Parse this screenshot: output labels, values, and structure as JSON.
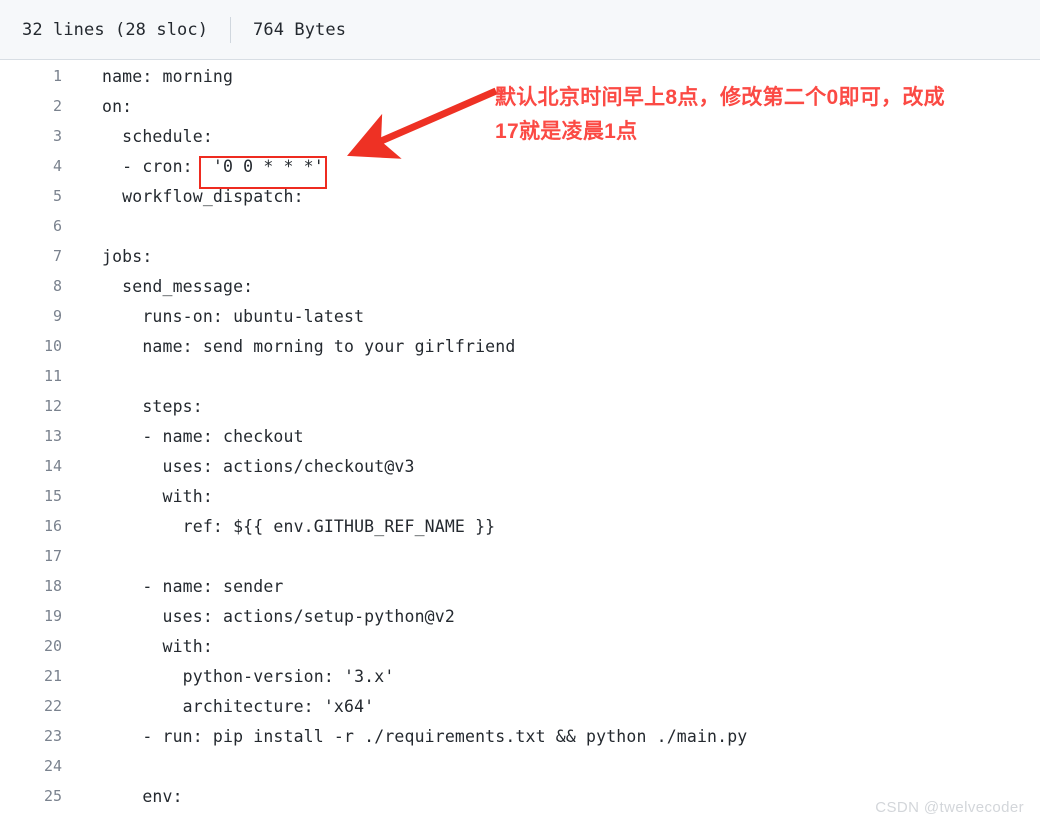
{
  "header": {
    "lines_label": "32 lines (28 sloc)",
    "size_label": "764 Bytes",
    "divider": "|"
  },
  "code": {
    "language": "yaml",
    "filename_hint": "morning workflow",
    "lines": [
      {
        "n": "1",
        "text": "name: morning"
      },
      {
        "n": "2",
        "text": "on:"
      },
      {
        "n": "3",
        "text": "  schedule:"
      },
      {
        "n": "4",
        "text": "  - cron:  '0 0 * * *'"
      },
      {
        "n": "5",
        "text": "  workflow_dispatch:"
      },
      {
        "n": "6",
        "text": ""
      },
      {
        "n": "7",
        "text": "jobs:"
      },
      {
        "n": "8",
        "text": "  send_message:"
      },
      {
        "n": "9",
        "text": "    runs-on: ubuntu-latest"
      },
      {
        "n": "10",
        "text": "    name: send morning to your girlfriend"
      },
      {
        "n": "11",
        "text": ""
      },
      {
        "n": "12",
        "text": "    steps:"
      },
      {
        "n": "13",
        "text": "    - name: checkout"
      },
      {
        "n": "14",
        "text": "      uses: actions/checkout@v3"
      },
      {
        "n": "15",
        "text": "      with:"
      },
      {
        "n": "16",
        "text": "        ref: ${{ env.GITHUB_REF_NAME }}"
      },
      {
        "n": "17",
        "text": ""
      },
      {
        "n": "18",
        "text": "    - name: sender"
      },
      {
        "n": "19",
        "text": "      uses: actions/setup-python@v2"
      },
      {
        "n": "20",
        "text": "      with:"
      },
      {
        "n": "21",
        "text": "        python-version: '3.x'"
      },
      {
        "n": "22",
        "text": "        architecture: 'x64'"
      },
      {
        "n": "23",
        "text": "    - run: pip install -r ./requirements.txt && python ./main.py"
      },
      {
        "n": "24",
        "text": ""
      },
      {
        "n": "25",
        "text": "    env:"
      }
    ]
  },
  "annotation": {
    "line1": "默认北京时间早上8点，修改第二个0即可，改成",
    "line2": "17就是凌晨1点",
    "color": "#fb4a44",
    "highlighted_value": "'0 0 * * *'",
    "highlight_border_color": "#ee2b20",
    "arrow_color": "#ee3124"
  },
  "watermark": {
    "text": "CSDN @twelvecoder"
  }
}
